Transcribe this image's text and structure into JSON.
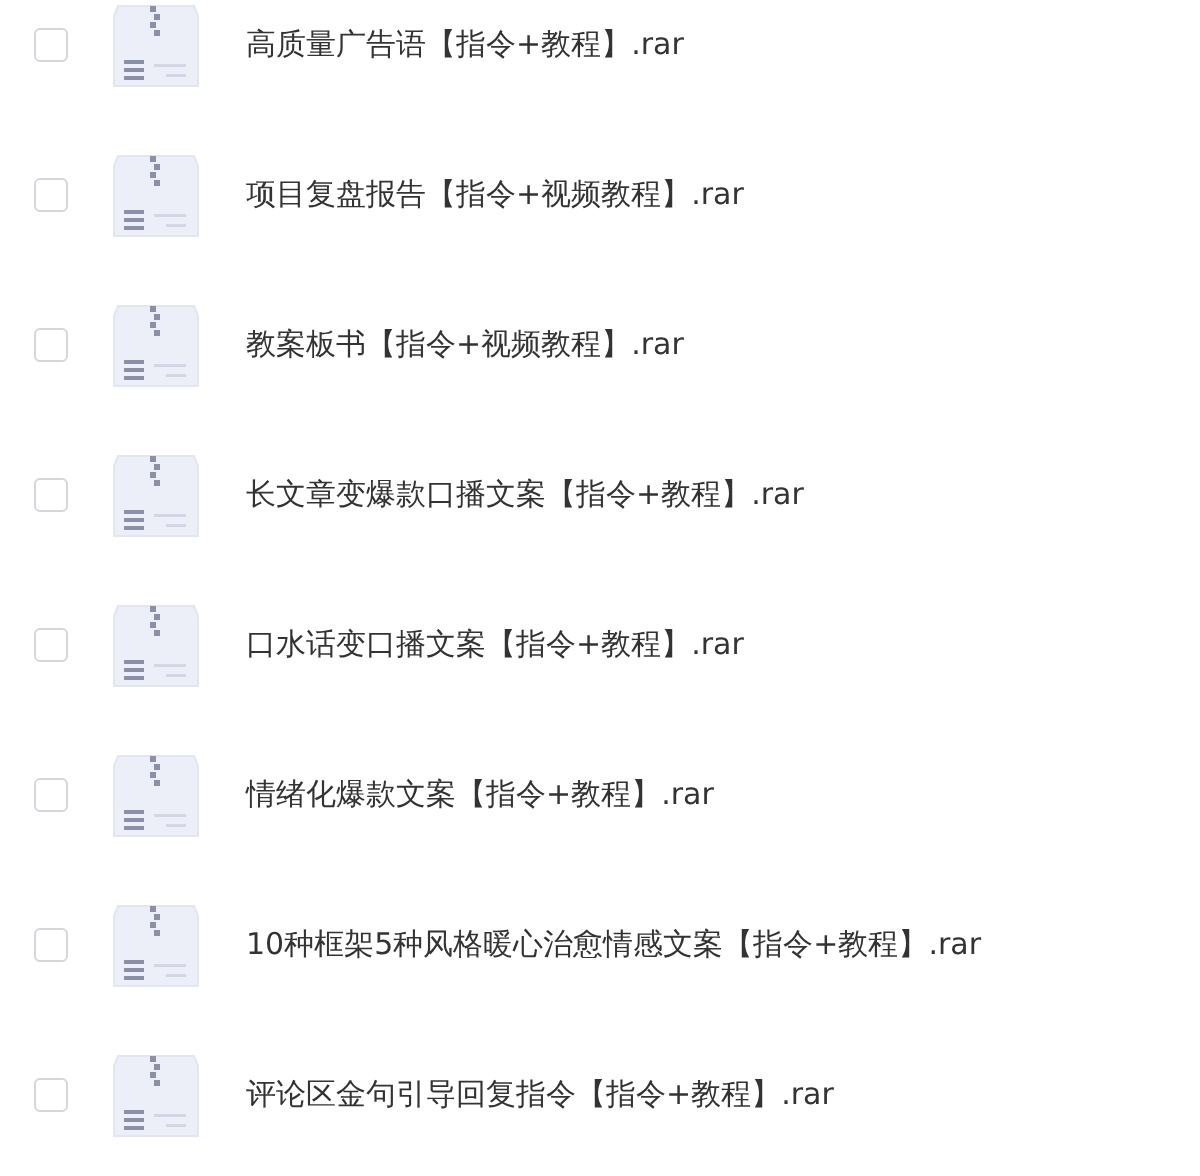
{
  "files": [
    {
      "name": "高质量广告语【指令+教程】.rar",
      "checked": false
    },
    {
      "name": "项目复盘报告【指令+视频教程】.rar",
      "checked": false
    },
    {
      "name": "教案板书【指令+视频教程】.rar",
      "checked": false
    },
    {
      "name": "长文章变爆款口播文案【指令+教程】.rar",
      "checked": false
    },
    {
      "name": "口水话变口播文案【指令+教程】.rar",
      "checked": false
    },
    {
      "name": "情绪化爆款文案【指令+教程】.rar",
      "checked": false
    },
    {
      "name": "10种框架5种风格暖心治愈情感文案【指令+教程】.rar",
      "checked": false
    },
    {
      "name": "评论区金句引导回复指令【指令+教程】.rar",
      "checked": false
    }
  ]
}
